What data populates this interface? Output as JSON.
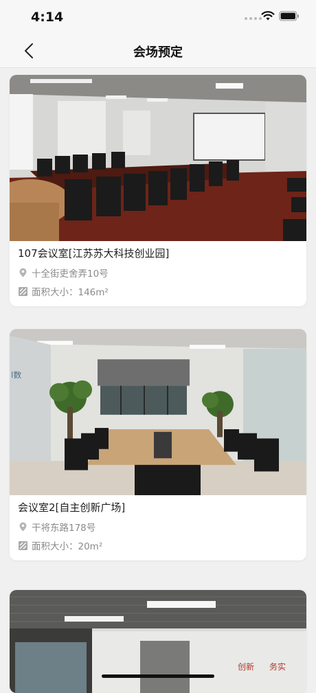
{
  "status": {
    "time": "4:14"
  },
  "nav": {
    "title": "会场预定"
  },
  "venues": [
    {
      "title": "107会议室[江苏苏大科技创业园]",
      "address": "十全街吏舍弄10号",
      "area": "面积大小：146m²"
    },
    {
      "title": "会议室2[自主创新广场]",
      "address": "干将东路178号",
      "area": "面积大小：20m²"
    },
    {
      "title": "",
      "address": "",
      "area": ""
    }
  ],
  "photo_text": {
    "wall_sign_1": "创新",
    "wall_sign_2": "务实",
    "wall_sign_3": "l数"
  },
  "icons": {
    "back": "chevron-left-icon",
    "location": "location-pin-icon",
    "area": "area-square-icon",
    "wifi": "wifi-icon",
    "battery": "battery-icon"
  },
  "colors": {
    "background": "#f0f0f0",
    "card": "#ffffff",
    "secondary_text": "#8a8a8a",
    "title_text": "#1e1e1e"
  }
}
